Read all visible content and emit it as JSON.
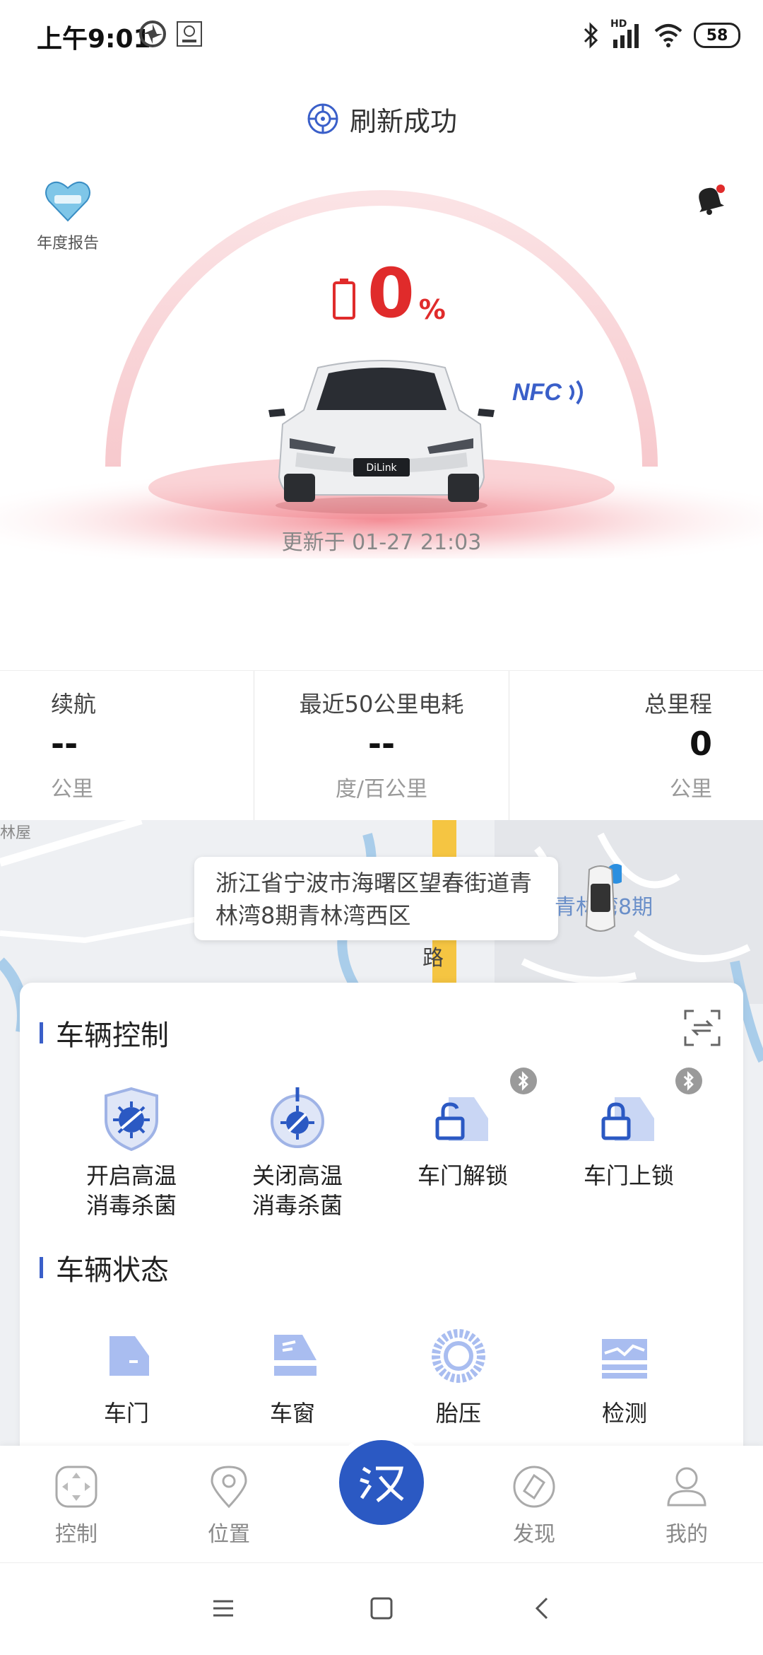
{
  "status_bar": {
    "time": "上午9:01",
    "network": "HD",
    "battery": "58"
  },
  "refresh": {
    "text": "刷新成功"
  },
  "hero": {
    "annual_report_label": "年度报告",
    "battery_value": "0",
    "battery_unit": "%",
    "nfc_label": "NFC",
    "car_plate_text": "DiLink",
    "update_time": "更新于 01-27 21:03",
    "accent_color": "#e02b2b",
    "battery_level_fraction": 0
  },
  "stats": [
    {
      "label": "续航",
      "value": "--",
      "unit": "公里"
    },
    {
      "label": "最近50公里电耗",
      "value": "--",
      "unit": "度/百公里"
    },
    {
      "label": "总里程",
      "value": "0",
      "unit": "公里"
    }
  ],
  "map": {
    "address": "浙江省宁波市海曙区望春街道青林湾8期青林湾西区",
    "poi_label": "青林湾8期",
    "road_text": "路",
    "corner_text": "林屋"
  },
  "vehicle_control": {
    "title": "车辆控制",
    "items": [
      {
        "label": "开启高温\n消毒杀菌",
        "icon": "shield-virus-icon"
      },
      {
        "label": "关闭高温\n消毒杀菌",
        "icon": "virus-power-icon"
      },
      {
        "label": "车门解锁",
        "icon": "door-unlock-icon",
        "bluetooth": true
      },
      {
        "label": "车门上锁",
        "icon": "door-lock-icon",
        "bluetooth": true
      }
    ]
  },
  "vehicle_status": {
    "title": "车辆状态",
    "items": [
      {
        "label": "车门",
        "icon": "door-icon"
      },
      {
        "label": "车窗",
        "icon": "window-icon"
      },
      {
        "label": "胎压",
        "icon": "tire-icon"
      },
      {
        "label": "检测",
        "icon": "inspect-icon"
      }
    ]
  },
  "bottom_nav": {
    "items": [
      {
        "label": "控制",
        "icon": "control-icon"
      },
      {
        "label": "位置",
        "icon": "location-icon"
      },
      {
        "label": "汉",
        "icon": "han-logo-icon"
      },
      {
        "label": "发现",
        "icon": "discover-icon"
      },
      {
        "label": "我的",
        "icon": "profile-icon"
      }
    ],
    "brand_color": "#2b59c3"
  }
}
